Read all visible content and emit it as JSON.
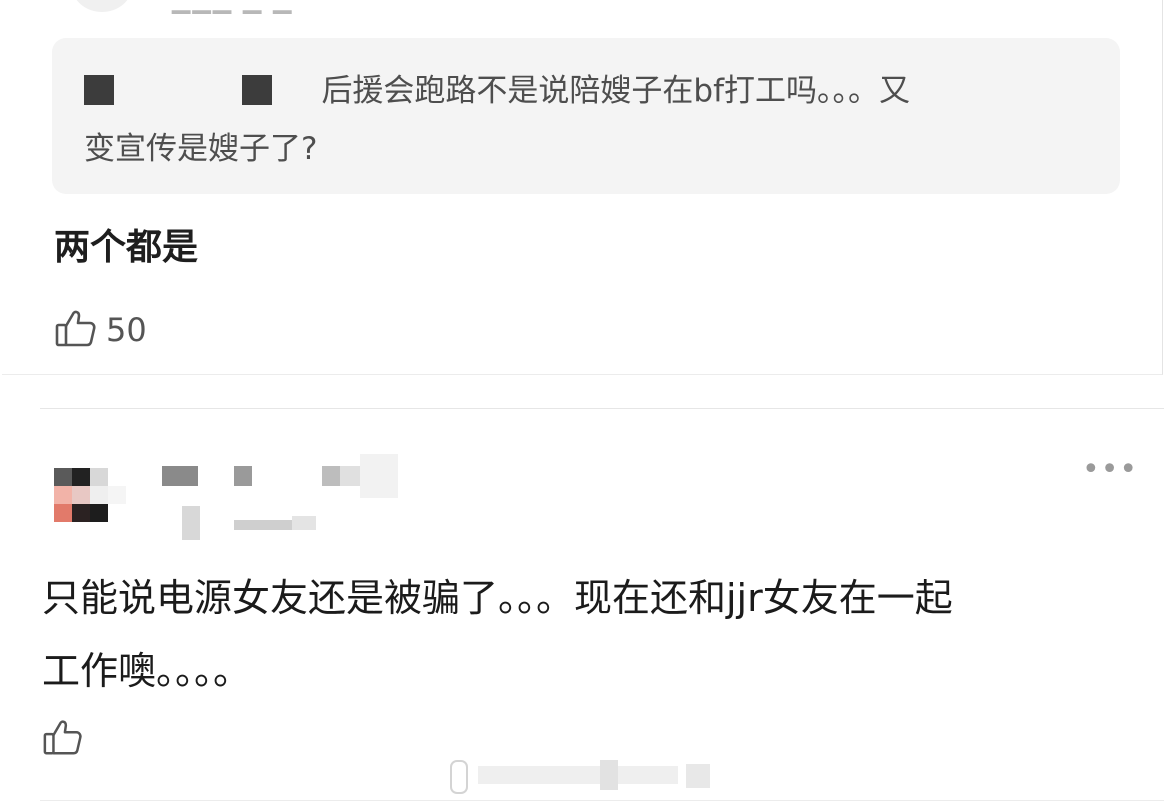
{
  "top_reply": {
    "quoted_text_line1": "后援会跑路不是说陪嫂子在bf打工吗。。。又",
    "quoted_text_line2": "变宣传是嫂子了?",
    "reply_text": "两个都是",
    "like_count": "50",
    "like_icon": "thumbs-up-icon"
  },
  "comment": {
    "text_line1": "只能说电源女友还是被骗了。。。现在还和jjr女友在一起",
    "text_line2": "工作噢。。。。",
    "more_icon": "more-icon",
    "more_glyph": "•••",
    "like_icon": "thumbs-up-icon"
  },
  "colors": {
    "quote_background": "#f4f4f4",
    "text_primary": "#1b1b1b",
    "text_secondary": "#4e4e4e",
    "icon_gray": "#555555"
  }
}
